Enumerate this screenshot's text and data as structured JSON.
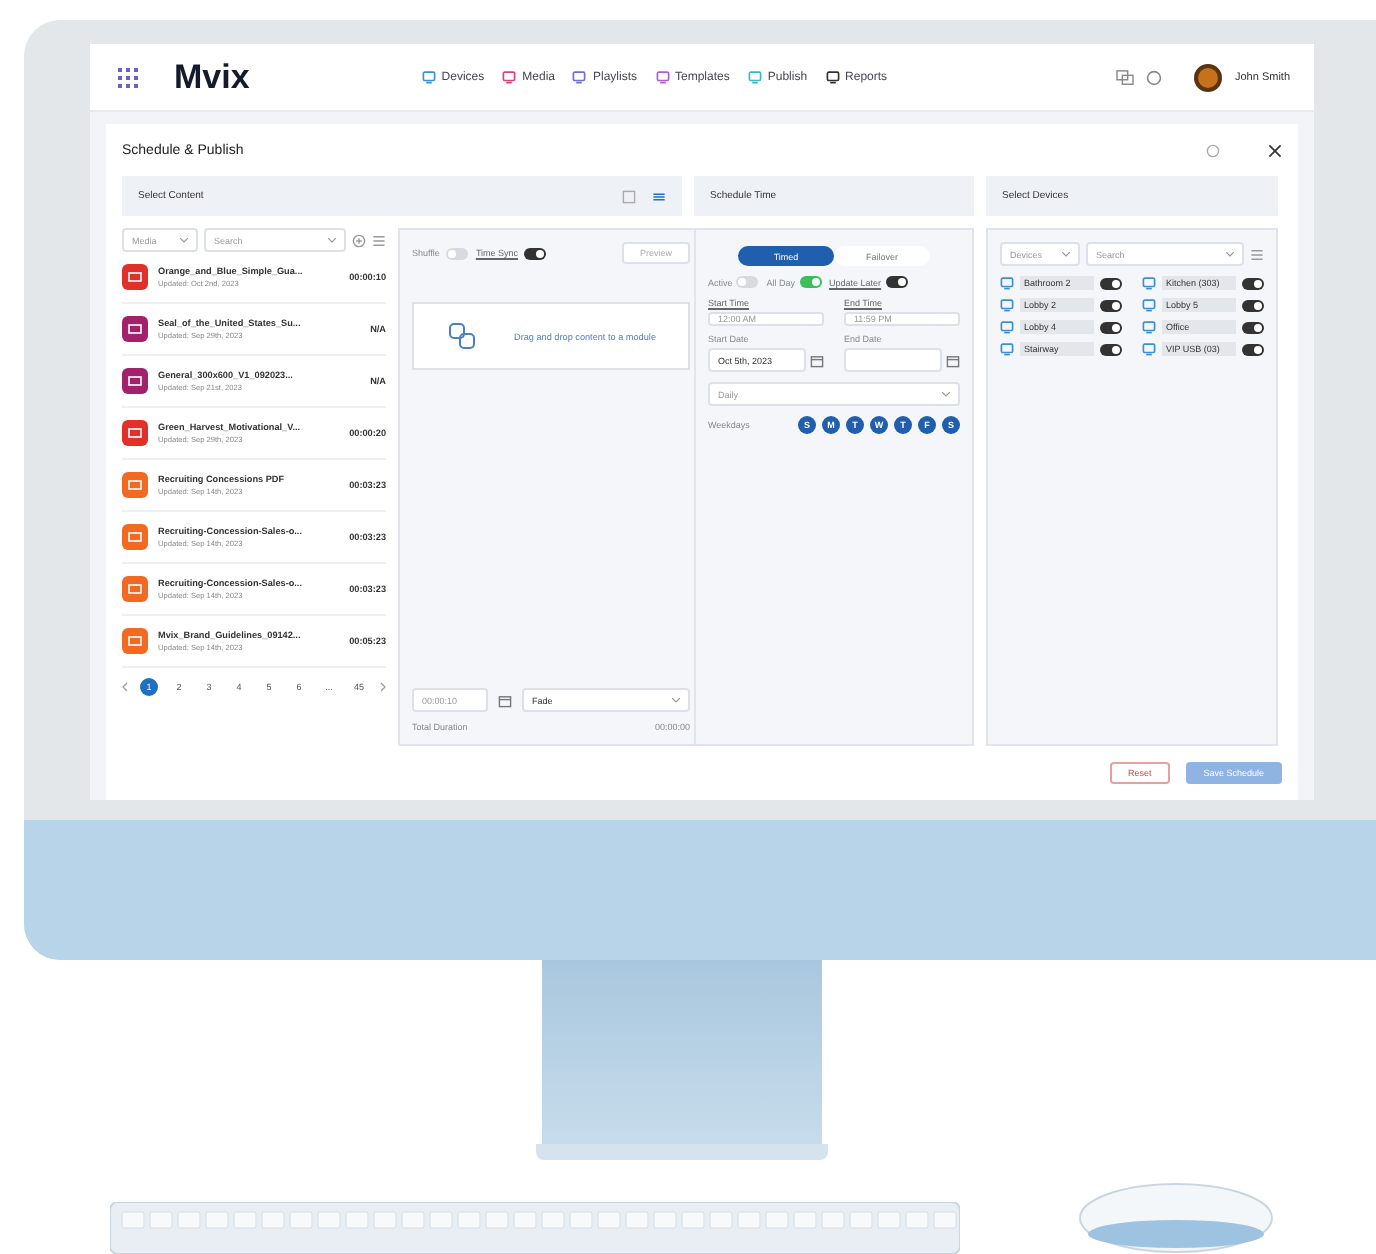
{
  "app": {
    "logo": "Mvix",
    "nav": [
      {
        "label": "Devices",
        "color": "#3b8fd9"
      },
      {
        "label": "Media",
        "color": "#e0407a"
      },
      {
        "label": "Playlists",
        "color": "#6a6fd8"
      },
      {
        "label": "Templates",
        "color": "#b05cd6"
      },
      {
        "label": "Publish",
        "color": "#3bb8c4"
      },
      {
        "label": "Reports",
        "color": "#333333"
      }
    ],
    "user": "John Smith"
  },
  "dialog": {
    "title": "Schedule & Publish",
    "content": {
      "title": "Select Content",
      "filter": "Media",
      "search": "Search",
      "items": [
        {
          "name": "Orange_and_Blue_Simple_Gua...",
          "updated": "Updated: Oct 2nd, 2023",
          "duration": "00:00:10",
          "color": "#e0302a"
        },
        {
          "name": "Seal_of_the_United_States_Su...",
          "updated": "Updated: Sep 29th, 2023",
          "duration": "N/A",
          "color": "#a3206b"
        },
        {
          "name": "General_300x600_V1_092023...",
          "updated": "Updated: Sep 21st, 2023",
          "duration": "N/A",
          "color": "#a3206b"
        },
        {
          "name": "Green_Harvest_Motivational_V...",
          "updated": "Updated: Sep 29th, 2023",
          "duration": "00:00:20",
          "color": "#e0302a"
        },
        {
          "name": "Recruiting Concessions PDF",
          "updated": "Updated: Sep 14th, 2023",
          "duration": "00:03:23",
          "color": "#f26a21"
        },
        {
          "name": "Recruiting-Concession-Sales-o...",
          "updated": "Updated: Sep 14th, 2023",
          "duration": "00:03:23",
          "color": "#f26a21"
        },
        {
          "name": "Recruiting-Concession-Sales-o...",
          "updated": "Updated: Sep 14th, 2023",
          "duration": "00:03:23",
          "color": "#f26a21"
        },
        {
          "name": "Mvix_Brand_Guidelines_09142...",
          "updated": "Updated: Sep 14th, 2023",
          "duration": "00:05:23",
          "color": "#f26a21"
        }
      ],
      "pages": [
        {
          "label": "1",
          "selected": true
        },
        {
          "label": "2",
          "selected": false
        },
        {
          "label": "3",
          "selected": false
        },
        {
          "label": "4",
          "selected": false
        },
        {
          "label": "5",
          "selected": false
        },
        {
          "label": "6",
          "selected": false
        },
        {
          "label": "...",
          "selected": false
        },
        {
          "label": "45",
          "selected": false
        }
      ]
    },
    "playlist": {
      "toggles": [
        {
          "label": "Shuffle",
          "on": false
        },
        {
          "label": "Time Sync",
          "on": true
        }
      ],
      "preview": "Preview",
      "drop_hint": "Drag and drop content to a module",
      "duration_field": "00:00:10",
      "transition": "Fade",
      "total_label": "Total Duration",
      "total": "00:00:00"
    },
    "schedule": {
      "title": "Schedule Time",
      "modes": [
        {
          "label": "Timed",
          "selected": true
        },
        {
          "label": "Failover",
          "selected": false
        }
      ],
      "toggles": [
        {
          "label": "Active",
          "on": false
        },
        {
          "label": "All Day",
          "on": true
        },
        {
          "label": "Update Later",
          "on": true
        }
      ],
      "start_time_label": "Start Time",
      "start_time": "12:00 AM",
      "end_time_label": "End Time",
      "end_time": "11:59 PM",
      "start_date_label": "Start Date",
      "start_date": "Oct 5th, 2023",
      "end_date_label": "End Date",
      "repeat": "Daily",
      "weekdays_label": "Weekdays",
      "days": [
        {
          "label": "S",
          "selected": true
        },
        {
          "label": "M",
          "selected": true
        },
        {
          "label": "T",
          "selected": true
        },
        {
          "label": "W",
          "selected": true
        },
        {
          "label": "T",
          "selected": true
        },
        {
          "label": "F",
          "selected": true
        },
        {
          "label": "S",
          "selected": true
        }
      ]
    },
    "devices": {
      "title": "Select Devices",
      "filter": "Devices",
      "search": "Search",
      "items": [
        {
          "name": "Bathroom 2",
          "on": true
        },
        {
          "name": "Kitchen (303)",
          "on": true
        },
        {
          "name": "Lobby 2",
          "on": true
        },
        {
          "name": "Lobby 5",
          "on": true
        },
        {
          "name": "Lobby 4",
          "on": true
        },
        {
          "name": "Office",
          "on": true
        },
        {
          "name": "Stairway",
          "on": true
        },
        {
          "name": "VIP USB (03)",
          "on": true
        }
      ]
    },
    "buttons": {
      "reset": "Reset",
      "save": "Save Schedule"
    }
  }
}
